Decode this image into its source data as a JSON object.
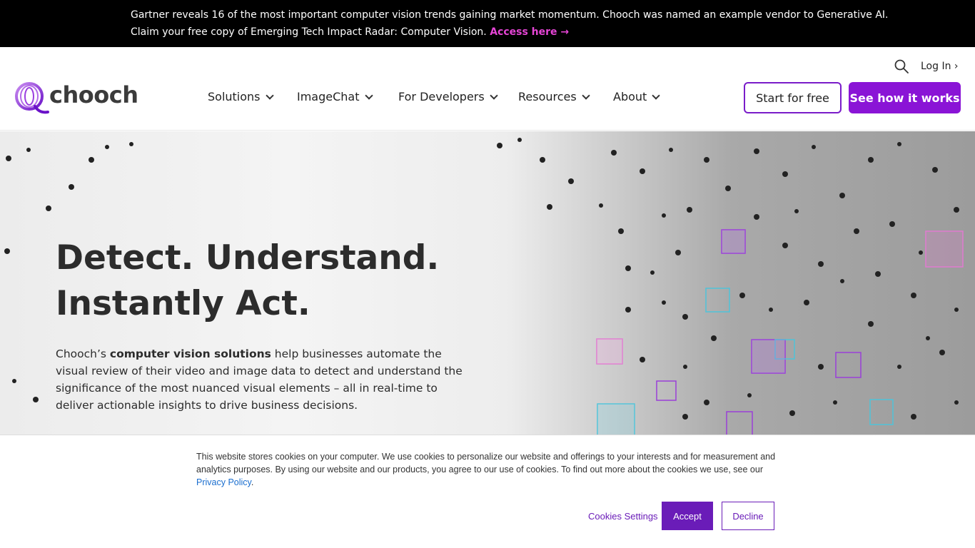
{
  "announcement": {
    "line1": "Gartner reveals 16 of the most important computer vision trends gaining market momentum. Chooch was named an example vendor to Generative AI.",
    "line2": "Claim your free copy of Emerging Tech Impact Radar: Computer Vision.",
    "link": "Access here →"
  },
  "header": {
    "logo_text": "chooch",
    "nav": [
      {
        "label": "Solutions"
      },
      {
        "label": "ImageChat"
      },
      {
        "label": "For Developers"
      },
      {
        "label": "Resources"
      },
      {
        "label": "About"
      }
    ],
    "login": "Log In ›",
    "start_free": "Start for free",
    "see_how": "See how it works"
  },
  "hero": {
    "title_line1": "Detect. Understand.",
    "title_line2": "Instantly Act.",
    "body_prefix": "Chooch’s ",
    "body_bold": "computer vision solutions",
    "body_suffix": " help businesses automate the visual review of their video and image data to detect and understand the significance of the most nuanced visual elements – all in real-time to deliver actionable insights to drive business decisions."
  },
  "cookie": {
    "text": "This website stores cookies on your computer. We use cookies to personalize our website and offerings to your interests and for measurement and analytics purposes. By using our website and our products, you agree to our use of cookies. To find out more about the cookies we use, see our ",
    "policy_link": "Privacy Policy",
    "period": ".",
    "settings": "Cookies Settings",
    "accept": "Accept",
    "decline": "Decline"
  },
  "colors": {
    "brand_purple": "#8a14d6",
    "announce_link": "#e645d6",
    "cookie_purple": "#6a1cb8"
  }
}
